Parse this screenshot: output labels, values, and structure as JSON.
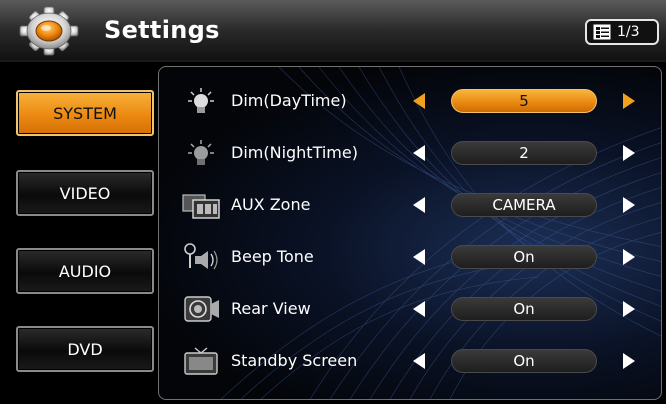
{
  "header": {
    "title": "Settings",
    "page_indicator": "1/3",
    "icons": [
      "gear-icon",
      "page-list-icon"
    ]
  },
  "nav": {
    "items": [
      {
        "label": "SYSTEM",
        "active": true
      },
      {
        "label": "VIDEO",
        "active": false
      },
      {
        "label": "AUDIO",
        "active": false
      },
      {
        "label": "DVD",
        "active": false
      }
    ]
  },
  "settings": {
    "rows": [
      {
        "label": "Dim(DayTime)",
        "value": "5",
        "icon": "sun-bulb-icon",
        "selected": true
      },
      {
        "label": "Dim(NightTime)",
        "value": "2",
        "icon": "moon-bulb-icon",
        "selected": false
      },
      {
        "label": "AUX Zone",
        "value": "CAMERA",
        "icon": "aux-zone-icon",
        "selected": false
      },
      {
        "label": "Beep Tone",
        "value": "On",
        "icon": "beep-speaker-icon",
        "selected": false
      },
      {
        "label": "Rear View",
        "value": "On",
        "icon": "rear-camera-icon",
        "selected": false
      },
      {
        "label": "Standby Screen",
        "value": "On",
        "icon": "tv-screen-icon",
        "selected": false
      }
    ]
  },
  "colors": {
    "accent": "#f2a11c",
    "panel_bg": "#0a1226",
    "text": "#ffffff"
  }
}
